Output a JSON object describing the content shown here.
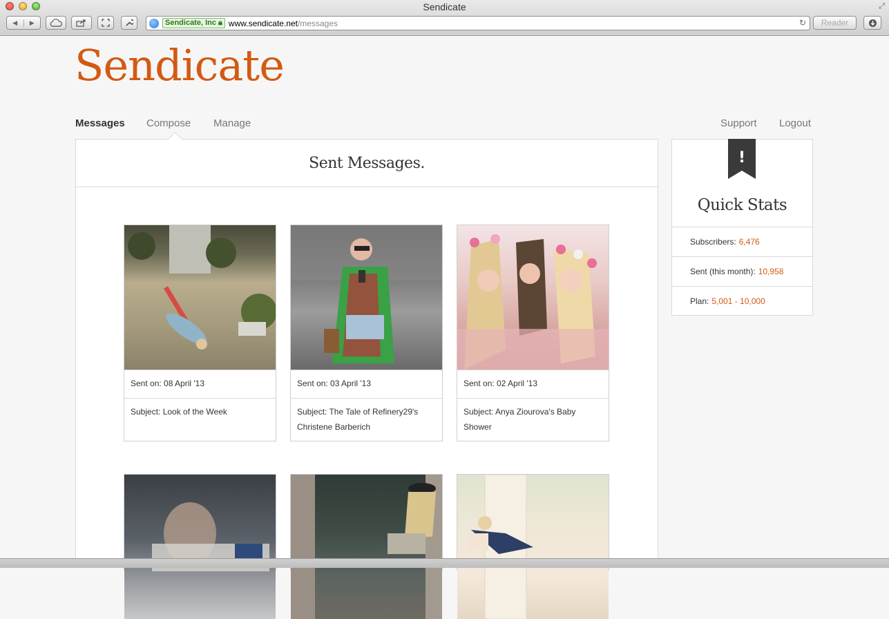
{
  "browser": {
    "window_title": "Sendicate",
    "ev_label": "Sendicate, Inc",
    "url_host": "www.sendicate.net",
    "url_path": "/messages",
    "reader_label": "Reader"
  },
  "site": {
    "logo": "Sendicate",
    "brand_color": "#d35a13"
  },
  "nav": {
    "left": [
      "Messages",
      "Compose",
      "Manage"
    ],
    "right": [
      "Support",
      "Logout"
    ],
    "active": "Messages"
  },
  "messages_panel": {
    "title": "Sent Messages.",
    "cards": [
      {
        "sent": "Sent on: 08 April '13",
        "subject": "Subject: Look of the Week"
      },
      {
        "sent": "Sent on: 03 April '13",
        "subject": "Subject: The Tale of Refinery29's Christene Barberich"
      },
      {
        "sent": "Sent on: 02 April '13",
        "subject": "Subject: Anya Ziourova's Baby Shower"
      }
    ]
  },
  "quick_stats": {
    "badge": "!",
    "title": "Quick Stats",
    "items": [
      {
        "label": "Subscribers:",
        "value": "6,476"
      },
      {
        "label": "Sent (this month):",
        "value": "10,958"
      },
      {
        "label": "Plan:",
        "value": "5,001 - 10,000"
      }
    ]
  }
}
